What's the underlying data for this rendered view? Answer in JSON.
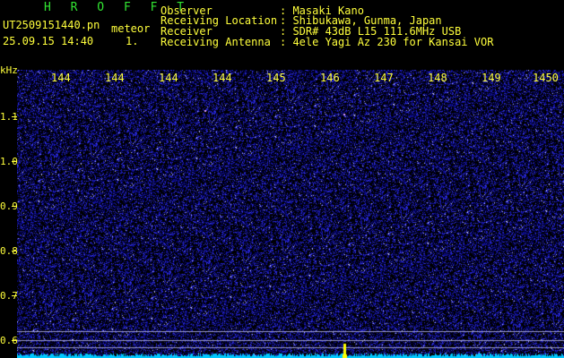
{
  "app": {
    "logo": "H R O F F T",
    "filename": "UT2509151440.pn",
    "meteor_label": "meteor",
    "datetime": "25.09.15 14:40",
    "count": "1."
  },
  "info": {
    "labels": [
      "Observer",
      "Receiving Location",
      "Receiver",
      "Receiving Antenna"
    ],
    "values": [
      ": Masaki Kano",
      ": Shibukawa, Gunma, Japan",
      ": SDR# 43dB L15 111.6MHz USB",
      ": 4ele Yagi Az 230 for Kansai VOR"
    ]
  },
  "x_axis": {
    "ticks": [
      "144",
      "144",
      "144",
      "144",
      "145",
      "146",
      "147",
      "148",
      "149",
      "1450"
    ]
  },
  "y_axis": {
    "unit": "kHz",
    "ticks": [
      "1.1",
      "1.0",
      "0.9",
      "0.8",
      "0.7",
      "0.6"
    ]
  },
  "colors": {
    "background": "#000000",
    "noise_dim": "#0a0a64",
    "noise_bright": "#3a3aff",
    "baseline": "#00c8ff",
    "event_marker": "#ffff00",
    "text": "#ffff3c",
    "logo": "#32e632"
  }
}
